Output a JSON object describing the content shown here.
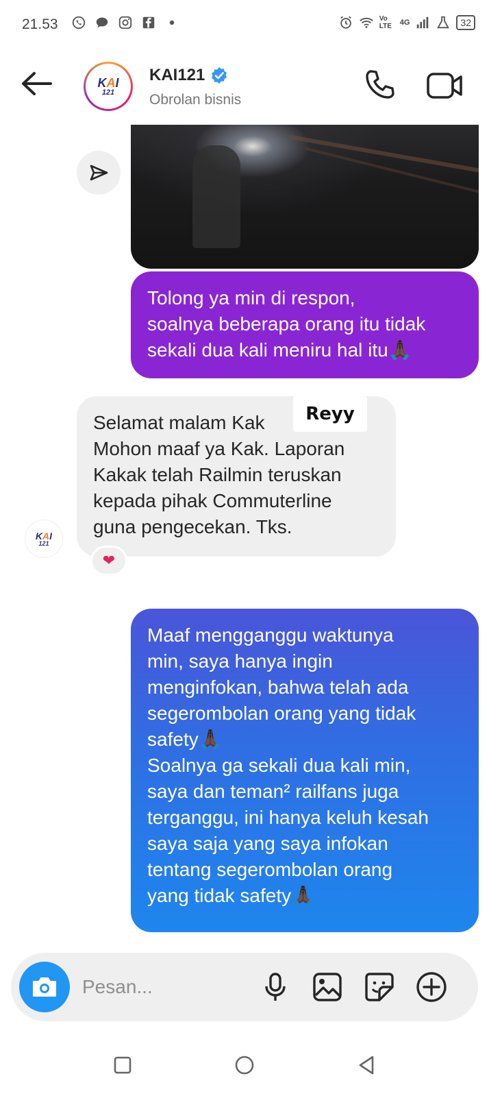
{
  "status_bar": {
    "time": "21.53",
    "battery": "32",
    "network": "4G",
    "volte": "Vo LTE"
  },
  "header": {
    "title": "KAI121",
    "subtitle": "Obrolan bisnis",
    "avatar_logo": {
      "k": "K",
      "a": "A",
      "i": "I",
      "num": "121"
    }
  },
  "messages": [
    {
      "type": "image",
      "direction": "sent"
    },
    {
      "type": "text",
      "direction": "sent",
      "text": "Tolong ya min di respon,\nsoalnya beberapa orang itu tidak\nsekali dua kali meniru hal itu🙏🏿"
    },
    {
      "type": "text",
      "direction": "received",
      "text": "Selamat malam Kak\nMohon maaf ya Kak. Laporan\nKakak telah Railmin teruskan\nkepada pihak Commuterline\nguna pengecekan. Tks.",
      "reaction": "❤"
    },
    {
      "type": "text",
      "direction": "sent",
      "text": "Maaf mengganggu waktunya\nmin, saya hanya ingin\nmenginfokan, bahwa telah ada\nsegerombolan orang yang tidak\nsafety🙏🏿\nSoalnya ga sekali dua kali min,\nsaya dan teman² railfans juga\nterganggu, ini hanya keluh kesah\nsaya saja yang saya infokan\ntentang segerombolan orang\nyang tidak safety🙏🏿"
    }
  ],
  "name_sticker": "Reyy",
  "composer": {
    "placeholder": "Pesan..."
  },
  "colors": {
    "sent_purple": "#8a25d4",
    "sent_gradient_top": "#4a55d8",
    "sent_gradient_bottom": "#1e86ee",
    "received_bg": "#efefef",
    "camera_blue": "#2196f3",
    "verified_blue": "#3897f0"
  }
}
